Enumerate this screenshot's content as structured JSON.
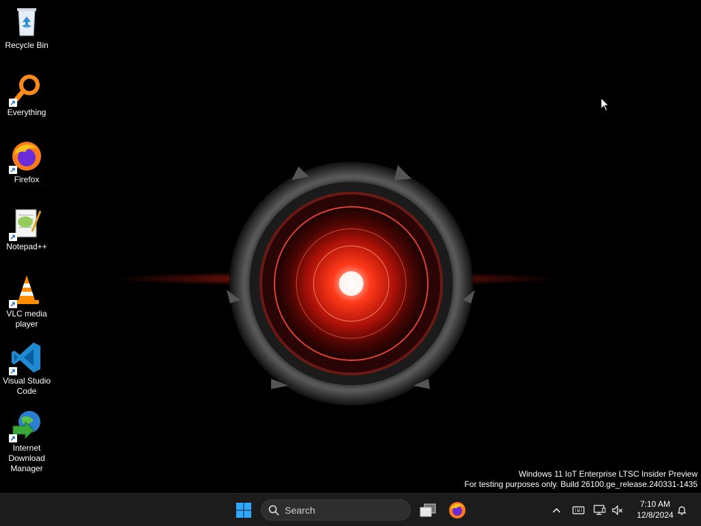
{
  "desktop": {
    "icons": [
      {
        "label": "Recycle Bin"
      },
      {
        "label": "Everything"
      },
      {
        "label": "Firefox"
      },
      {
        "label": "Notepad++"
      },
      {
        "label": "VLC media\nplayer"
      },
      {
        "label": "Visual Studio\nCode"
      },
      {
        "label": "Internet\nDownload\nManager"
      }
    ]
  },
  "watermark": {
    "line1": "Windows 11 IoT Enterprise LTSC Insider Preview",
    "line2": "For testing purposes only. Build 26100.ge_release.240331-1435"
  },
  "taskbar": {
    "search_label": "Search",
    "clock_time": "7:10 AM",
    "clock_date": "12/8/2024"
  },
  "colors": {
    "accent": "#0078d4",
    "taskbar_bg": "#1c1c1c",
    "wallpaper_glow": "#ff2a10"
  }
}
